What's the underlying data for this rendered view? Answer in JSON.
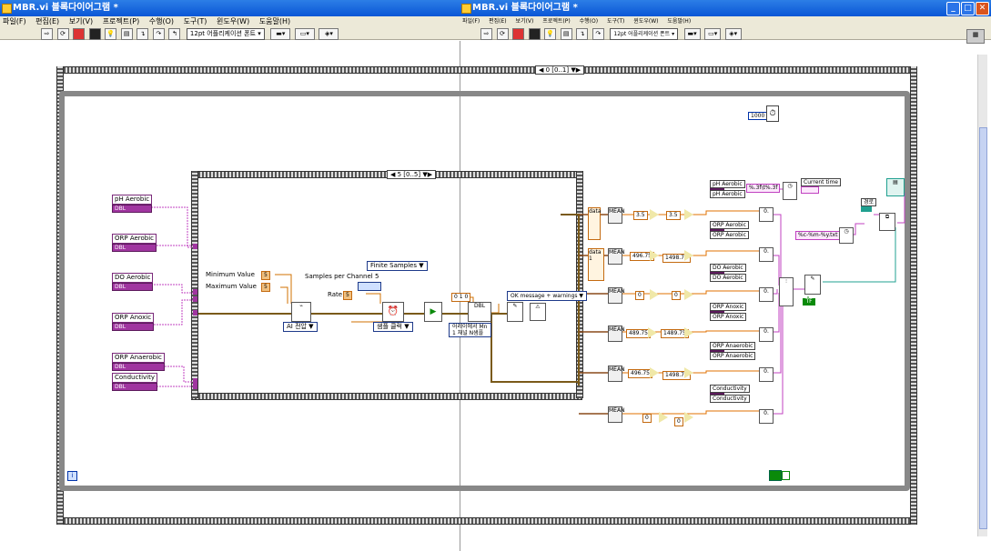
{
  "left_window": {
    "title": "MBR.vi 블록다이어그램 *",
    "menu": [
      "파일(F)",
      "편집(E)",
      "보기(V)",
      "프로젝트(P)",
      "수행(O)",
      "도구(T)",
      "윈도우(W)",
      "도움말(H)"
    ],
    "font_selector": "12pt 어플리케이션 폰트"
  },
  "right_window": {
    "title": "MBR.vi 블록다이어그램 *",
    "menu": [
      "파일(F)",
      "편집(E)",
      "보기(V)",
      "프로젝트(P)",
      "수행(O)",
      "도구(T)",
      "윈도우(W)",
      "도움말(H)"
    ],
    "font_selector": "12pt 어플리케이션 폰트"
  },
  "diagram": {
    "outer_sequence_label": "◀ 0 [0..1] ▼▶",
    "inner_sequence_label": "◀ 5 [0..5] ▼▶",
    "loop_iteration": "i",
    "loop_count": "1000",
    "controls": [
      {
        "label": "pH Aerobic",
        "terminal": "DBL"
      },
      {
        "label": "ORP Aerobic",
        "terminal": "DBL"
      },
      {
        "label": "DO Aerobic",
        "terminal": "DBL"
      },
      {
        "label": "ORP Anoxic",
        "terminal": "DBL"
      },
      {
        "label": "ORP Anaerobic",
        "terminal": "DBL"
      },
      {
        "label": "Conductivity",
        "terminal": "DBL"
      }
    ],
    "daq": {
      "min_label": "Minimum Value",
      "min_value": "5",
      "max_label": "Maximum Value",
      "max_value": "5",
      "spc_label": "Samples per Channel",
      "spc_value": "5",
      "rate_label": "Rate",
      "rate_value": "5",
      "finite_samples": "Finite Samples ▼",
      "ai_voltage": "AI 전압 ▼",
      "sample_clock": "샘플 클럭 ▼",
      "index_const": "0 1 0",
      "ok_message": "OK message + warnings ▼",
      "gen_text_1": "어레이에서 Mn",
      "gen_text_2": "1 채널 N샘플"
    },
    "processing_rows": [
      {
        "const": "data",
        "v1": "3.5",
        "v2": "3.5"
      },
      {
        "const": "data 1",
        "v1": "496.75",
        "v2": "1498.75"
      },
      {
        "const": "",
        "v1": "0",
        "v2": "0"
      },
      {
        "const": "",
        "v1": "489.75",
        "v2": "1489.75"
      },
      {
        "const": "",
        "v1": "496.75",
        "v2": "1498.75"
      },
      {
        "const": "",
        "v1": "0",
        "v2": "0"
      }
    ],
    "indicators": [
      [
        "pH Aerobic",
        "pH Aerobic"
      ],
      [
        "ORP Aerobic",
        "ORP Aerobic"
      ],
      [
        "DO Aerobic",
        "DO Aerobic"
      ],
      [
        "ORP Anoxic",
        "ORP Anoxic"
      ],
      [
        "ORP Anaerobic",
        "ORP Anaerobic"
      ],
      [
        "Conductivity",
        "Conductivity"
      ]
    ],
    "format_string": "%.3f\\t%.3f",
    "current_time": "Current time",
    "date_format": "%c-%m-%y.txt",
    "path_label": "경로",
    "true_const": "TF"
  }
}
